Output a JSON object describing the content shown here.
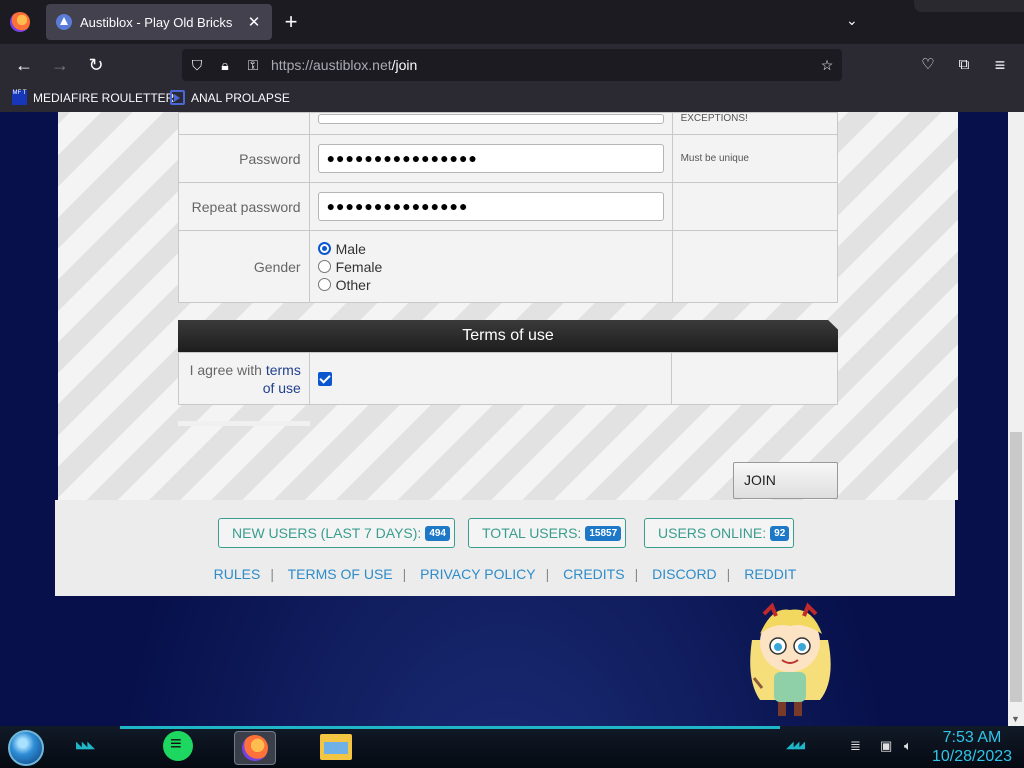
{
  "browser": {
    "tab_title": "Austiblox - Play Old Bricks",
    "url_host": "https://austiblox.net",
    "url_path": "/join",
    "bookmarks": [
      {
        "label": "MEDIAFIRE ROULETTER",
        "icon": "mft-icon"
      },
      {
        "label": "ANAL PROLAPSE",
        "icon": "bookmark-icon"
      }
    ],
    "bookmark_icon_text": "MF T"
  },
  "form": {
    "email_note": "EXCEPTIONS!",
    "password_label": "Password",
    "password_value": "●●●●●●●●●●●●●●●●",
    "password_note": "Must be unique",
    "repeat_label": "Repeat password",
    "repeat_value": "●●●●●●●●●●●●●●●",
    "gender_label": "Gender",
    "gender_options": [
      "Male",
      "Female",
      "Other"
    ],
    "gender_selected": "Male",
    "terms_heading": "Terms of use",
    "agree_prefix": "I agree with",
    "agree_link": "terms of use",
    "agree_checked": true,
    "join_label": "JOIN"
  },
  "footer": {
    "stats": [
      {
        "label": "NEW USERS (LAST 7 DAYS):",
        "value": "494"
      },
      {
        "label": "TOTAL USERS:",
        "value": "15857"
      },
      {
        "label": "USERS ONLINE:",
        "value": "92"
      }
    ],
    "links": [
      "RULES",
      "TERMS OF USE",
      "PRIVACY POLICY",
      "CREDITS",
      "DISCORD",
      "REDDIT"
    ]
  },
  "taskbar": {
    "time": "7:53 AM",
    "date": "10/28/2023"
  },
  "colors": {
    "accent": "#0b57d0",
    "footer_teal": "#3a9d8f",
    "badge_blue": "#1e78c8",
    "link_blue": "#2d8cc9"
  }
}
